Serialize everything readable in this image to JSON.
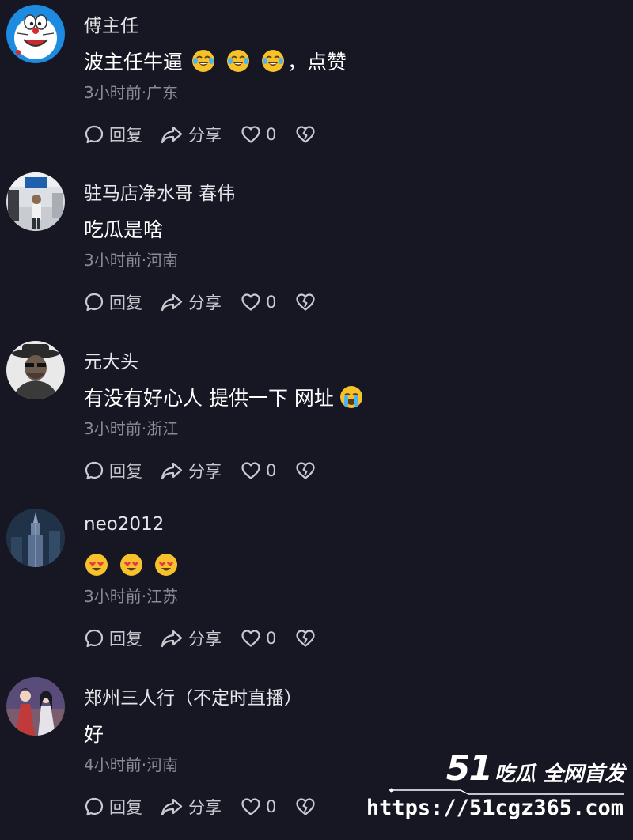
{
  "comments": [
    {
      "username": "傅主任",
      "text": "波主任牛逼",
      "emojis": [
        "crying-laugh",
        "crying-laugh",
        "crying-laugh"
      ],
      "suffix": "，点赞",
      "meta": "3小时前·广东",
      "reply_label": "回复",
      "share_label": "分享",
      "likes": "0",
      "avatar": "doraemon-avatar"
    },
    {
      "username": "驻马店净水哥 春伟",
      "text": "吃瓜是啥",
      "emojis": [],
      "suffix": "",
      "meta": "3小时前·河南",
      "reply_label": "回复",
      "share_label": "分享",
      "likes": "0",
      "avatar": "store-photo-avatar"
    },
    {
      "username": "元大头",
      "text": "有没有好心人 提供一下 网址",
      "emojis": [
        "loudly-crying"
      ],
      "suffix": "",
      "meta": "3小时前·浙江",
      "reply_label": "回复",
      "share_label": "分享",
      "likes": "0",
      "avatar": "hat-man-avatar"
    },
    {
      "username": "neo2012",
      "text": "",
      "emojis": [
        "heart-eyes",
        "heart-eyes",
        "heart-eyes"
      ],
      "suffix": "",
      "meta": "3小时前·江苏",
      "reply_label": "回复",
      "share_label": "分享",
      "likes": "0",
      "avatar": "skyscraper-avatar"
    },
    {
      "username": "郑州三人行（不定时直播）",
      "text": "好",
      "emojis": [],
      "suffix": "",
      "meta": "4小时前·河南",
      "reply_label": "回复",
      "share_label": "分享",
      "likes": "0",
      "avatar": "painting-avatar"
    }
  ],
  "watermark": {
    "number": "51",
    "title": "吃瓜 全网首发",
    "url": "https://51cgz365.com"
  },
  "colors": {
    "background": "#161722",
    "meta_text": "#8a8b94",
    "action_text": "#c9c9cf"
  }
}
